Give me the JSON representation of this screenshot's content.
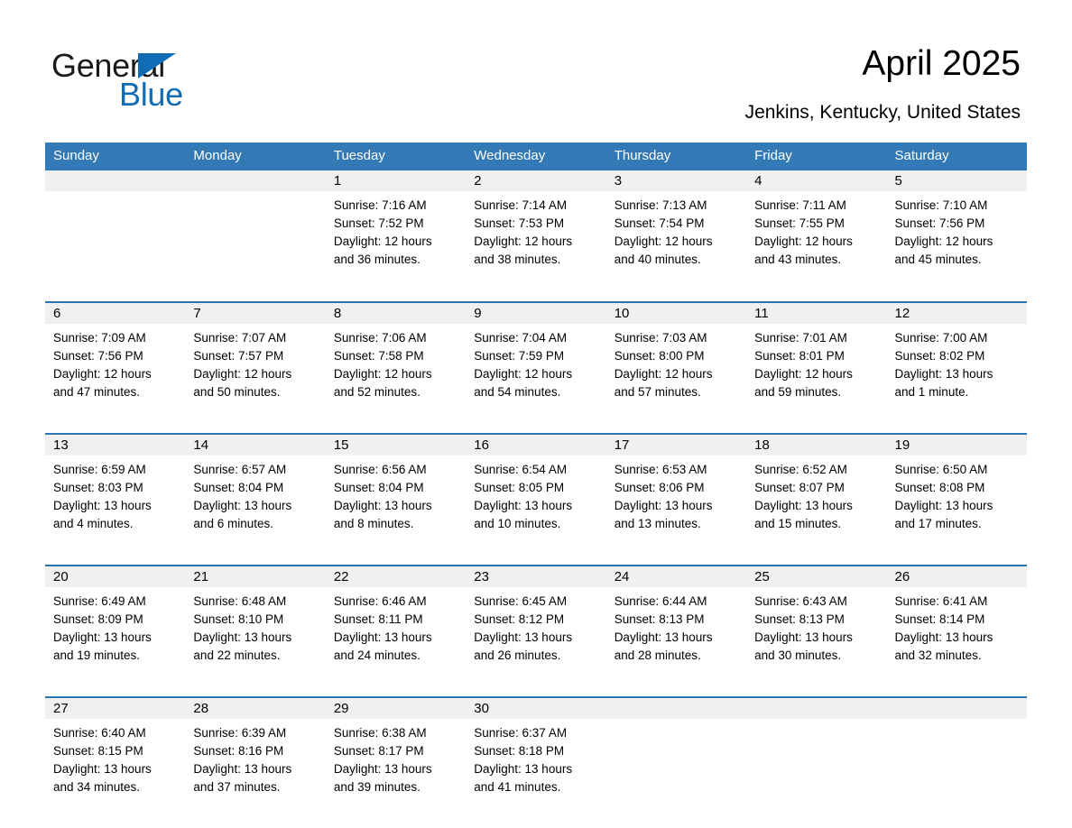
{
  "brand": {
    "name_part1": "General",
    "name_part2": "Blue",
    "triangle_color": "#0f6cb5",
    "text_color": "#1a1a1a"
  },
  "header": {
    "title": "April 2025",
    "location": "Jenkins, Kentucky, United States"
  },
  "calendar": {
    "header_background": "#3279b6",
    "header_text_color": "#ffffff",
    "row_border_color": "#2e74b5",
    "date_band_background": "#f0f0f0",
    "weekday_headers": [
      "Sunday",
      "Monday",
      "Tuesday",
      "Wednesday",
      "Thursday",
      "Friday",
      "Saturday"
    ],
    "weeks": [
      [
        {
          "date": "",
          "sunrise": "",
          "sunset": "",
          "daylight_line1": "",
          "daylight_line2": ""
        },
        {
          "date": "",
          "sunrise": "",
          "sunset": "",
          "daylight_line1": "",
          "daylight_line2": ""
        },
        {
          "date": "1",
          "sunrise": "Sunrise: 7:16 AM",
          "sunset": "Sunset: 7:52 PM",
          "daylight_line1": "Daylight: 12 hours",
          "daylight_line2": "and 36 minutes."
        },
        {
          "date": "2",
          "sunrise": "Sunrise: 7:14 AM",
          "sunset": "Sunset: 7:53 PM",
          "daylight_line1": "Daylight: 12 hours",
          "daylight_line2": "and 38 minutes."
        },
        {
          "date": "3",
          "sunrise": "Sunrise: 7:13 AM",
          "sunset": "Sunset: 7:54 PM",
          "daylight_line1": "Daylight: 12 hours",
          "daylight_line2": "and 40 minutes."
        },
        {
          "date": "4",
          "sunrise": "Sunrise: 7:11 AM",
          "sunset": "Sunset: 7:55 PM",
          "daylight_line1": "Daylight: 12 hours",
          "daylight_line2": "and 43 minutes."
        },
        {
          "date": "5",
          "sunrise": "Sunrise: 7:10 AM",
          "sunset": "Sunset: 7:56 PM",
          "daylight_line1": "Daylight: 12 hours",
          "daylight_line2": "and 45 minutes."
        }
      ],
      [
        {
          "date": "6",
          "sunrise": "Sunrise: 7:09 AM",
          "sunset": "Sunset: 7:56 PM",
          "daylight_line1": "Daylight: 12 hours",
          "daylight_line2": "and 47 minutes."
        },
        {
          "date": "7",
          "sunrise": "Sunrise: 7:07 AM",
          "sunset": "Sunset: 7:57 PM",
          "daylight_line1": "Daylight: 12 hours",
          "daylight_line2": "and 50 minutes."
        },
        {
          "date": "8",
          "sunrise": "Sunrise: 7:06 AM",
          "sunset": "Sunset: 7:58 PM",
          "daylight_line1": "Daylight: 12 hours",
          "daylight_line2": "and 52 minutes."
        },
        {
          "date": "9",
          "sunrise": "Sunrise: 7:04 AM",
          "sunset": "Sunset: 7:59 PM",
          "daylight_line1": "Daylight: 12 hours",
          "daylight_line2": "and 54 minutes."
        },
        {
          "date": "10",
          "sunrise": "Sunrise: 7:03 AM",
          "sunset": "Sunset: 8:00 PM",
          "daylight_line1": "Daylight: 12 hours",
          "daylight_line2": "and 57 minutes."
        },
        {
          "date": "11",
          "sunrise": "Sunrise: 7:01 AM",
          "sunset": "Sunset: 8:01 PM",
          "daylight_line1": "Daylight: 12 hours",
          "daylight_line2": "and 59 minutes."
        },
        {
          "date": "12",
          "sunrise": "Sunrise: 7:00 AM",
          "sunset": "Sunset: 8:02 PM",
          "daylight_line1": "Daylight: 13 hours",
          "daylight_line2": "and 1 minute."
        }
      ],
      [
        {
          "date": "13",
          "sunrise": "Sunrise: 6:59 AM",
          "sunset": "Sunset: 8:03 PM",
          "daylight_line1": "Daylight: 13 hours",
          "daylight_line2": "and 4 minutes."
        },
        {
          "date": "14",
          "sunrise": "Sunrise: 6:57 AM",
          "sunset": "Sunset: 8:04 PM",
          "daylight_line1": "Daylight: 13 hours",
          "daylight_line2": "and 6 minutes."
        },
        {
          "date": "15",
          "sunrise": "Sunrise: 6:56 AM",
          "sunset": "Sunset: 8:04 PM",
          "daylight_line1": "Daylight: 13 hours",
          "daylight_line2": "and 8 minutes."
        },
        {
          "date": "16",
          "sunrise": "Sunrise: 6:54 AM",
          "sunset": "Sunset: 8:05 PM",
          "daylight_line1": "Daylight: 13 hours",
          "daylight_line2": "and 10 minutes."
        },
        {
          "date": "17",
          "sunrise": "Sunrise: 6:53 AM",
          "sunset": "Sunset: 8:06 PM",
          "daylight_line1": "Daylight: 13 hours",
          "daylight_line2": "and 13 minutes."
        },
        {
          "date": "18",
          "sunrise": "Sunrise: 6:52 AM",
          "sunset": "Sunset: 8:07 PM",
          "daylight_line1": "Daylight: 13 hours",
          "daylight_line2": "and 15 minutes."
        },
        {
          "date": "19",
          "sunrise": "Sunrise: 6:50 AM",
          "sunset": "Sunset: 8:08 PM",
          "daylight_line1": "Daylight: 13 hours",
          "daylight_line2": "and 17 minutes."
        }
      ],
      [
        {
          "date": "20",
          "sunrise": "Sunrise: 6:49 AM",
          "sunset": "Sunset: 8:09 PM",
          "daylight_line1": "Daylight: 13 hours",
          "daylight_line2": "and 19 minutes."
        },
        {
          "date": "21",
          "sunrise": "Sunrise: 6:48 AM",
          "sunset": "Sunset: 8:10 PM",
          "daylight_line1": "Daylight: 13 hours",
          "daylight_line2": "and 22 minutes."
        },
        {
          "date": "22",
          "sunrise": "Sunrise: 6:46 AM",
          "sunset": "Sunset: 8:11 PM",
          "daylight_line1": "Daylight: 13 hours",
          "daylight_line2": "and 24 minutes."
        },
        {
          "date": "23",
          "sunrise": "Sunrise: 6:45 AM",
          "sunset": "Sunset: 8:12 PM",
          "daylight_line1": "Daylight: 13 hours",
          "daylight_line2": "and 26 minutes."
        },
        {
          "date": "24",
          "sunrise": "Sunrise: 6:44 AM",
          "sunset": "Sunset: 8:13 PM",
          "daylight_line1": "Daylight: 13 hours",
          "daylight_line2": "and 28 minutes."
        },
        {
          "date": "25",
          "sunrise": "Sunrise: 6:43 AM",
          "sunset": "Sunset: 8:13 PM",
          "daylight_line1": "Daylight: 13 hours",
          "daylight_line2": "and 30 minutes."
        },
        {
          "date": "26",
          "sunrise": "Sunrise: 6:41 AM",
          "sunset": "Sunset: 8:14 PM",
          "daylight_line1": "Daylight: 13 hours",
          "daylight_line2": "and 32 minutes."
        }
      ],
      [
        {
          "date": "27",
          "sunrise": "Sunrise: 6:40 AM",
          "sunset": "Sunset: 8:15 PM",
          "daylight_line1": "Daylight: 13 hours",
          "daylight_line2": "and 34 minutes."
        },
        {
          "date": "28",
          "sunrise": "Sunrise: 6:39 AM",
          "sunset": "Sunset: 8:16 PM",
          "daylight_line1": "Daylight: 13 hours",
          "daylight_line2": "and 37 minutes."
        },
        {
          "date": "29",
          "sunrise": "Sunrise: 6:38 AM",
          "sunset": "Sunset: 8:17 PM",
          "daylight_line1": "Daylight: 13 hours",
          "daylight_line2": "and 39 minutes."
        },
        {
          "date": "30",
          "sunrise": "Sunrise: 6:37 AM",
          "sunset": "Sunset: 8:18 PM",
          "daylight_line1": "Daylight: 13 hours",
          "daylight_line2": "and 41 minutes."
        },
        {
          "date": "",
          "sunrise": "",
          "sunset": "",
          "daylight_line1": "",
          "daylight_line2": ""
        },
        {
          "date": "",
          "sunrise": "",
          "sunset": "",
          "daylight_line1": "",
          "daylight_line2": ""
        },
        {
          "date": "",
          "sunrise": "",
          "sunset": "",
          "daylight_line1": "",
          "daylight_line2": ""
        }
      ]
    ]
  }
}
